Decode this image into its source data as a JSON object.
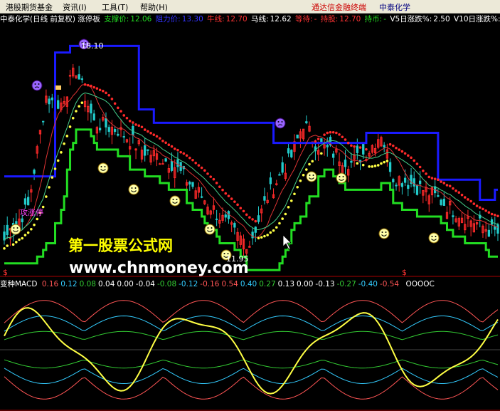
{
  "menu": {
    "items": [
      "港股期货基金",
      "资讯(I)",
      "工具(T)",
      "帮助(H)"
    ],
    "brand": "通达信金融终端",
    "stock": "中泰化学"
  },
  "info": {
    "title": "中泰化学(日线 前复权) 涨停板",
    "support_label": "支撑价:",
    "support_value": "12.06",
    "resist_label": "阻力价:",
    "resist_value": "13.30",
    "bull_label": "牛线:",
    "bull_value": "12.70",
    "horse_label": "马线:",
    "horse_value": "12.62",
    "wait_label": "等待:",
    "wait_value": "-",
    "hold_label": "持股:",
    "hold_value": "12.70",
    "cash_label": "持币:",
    "cash_value": "-",
    "v5_label": "V5日涨跌%:",
    "v5_value": "2.50",
    "v10_label": "V10日涨跌%:",
    "v10_value": "-"
  },
  "macd": {
    "label": "变种MACD",
    "values": [
      "0.16",
      "0.12",
      "0.08",
      "0.04",
      "0.00",
      "-0.04",
      "-0.08",
      "-0.12",
      "-0.16",
      "0.54",
      "0.40",
      "0.27",
      "0.13",
      "0.00",
      "-0.13",
      "-0.27",
      "-0.40",
      "-0.54"
    ],
    "colors": [
      "#ff5555",
      "#33ccff",
      "#33cc33",
      "#ffffff",
      "#ffffff",
      "#ffffff",
      "#33cc33",
      "#33ccff",
      "#ff5555",
      "#ff5555",
      "#33ccff",
      "#33cc33",
      "#ffffff",
      "#ffffff",
      "#ffffff",
      "#33cc33",
      "#33ccff",
      "#ff5555"
    ],
    "tail": "OOOOC"
  },
  "annotations": {
    "high_price": "18.10",
    "low_price": "11.95",
    "limit_up_text": "攻涨停",
    "dollar_1": "$",
    "dollar_2": "$"
  },
  "watermark": {
    "line1": "第一股票公式网",
    "line2": "www.chnmoney.com"
  },
  "colors": {
    "resistance": "#1a1aff",
    "support": "#22dd22",
    "up_candle": "#ff2a2a",
    "down_candle": "#22cccc",
    "red_dots": "#ff2a2a",
    "yellow_dots": "#ffff44",
    "macd_main": "#ffff44",
    "watermark1": "#ffff00",
    "watermark2": "#ffffff"
  },
  "chart_data": {
    "type": "candlestick",
    "price_high_marked": 18.1,
    "price_low_marked": 11.95,
    "resistance_line": [
      14.2,
      14.2,
      14.2,
      14.2,
      14.2,
      14.2,
      14.2,
      14.2,
      14.2,
      14.2,
      14.2,
      14.2,
      14.2,
      14.2,
      14.2,
      14.2,
      14.2,
      17.9,
      17.9,
      17.9,
      17.9,
      17.9,
      18.1,
      18.1,
      18.1,
      18.1,
      18.1,
      18.1,
      18.1,
      18.1,
      18.1,
      18.1,
      18.1,
      18.1,
      18.1,
      18.1,
      18.1,
      18.1,
      18.1,
      18.1,
      18.1,
      18.1,
      18.1,
      18.1,
      18.1,
      16.2,
      16.2,
      16.2,
      16.2,
      16.2,
      15.8,
      15.8,
      15.8,
      15.8,
      15.8,
      15.8,
      15.8,
      15.8,
      15.8,
      15.8,
      15.8,
      15.8,
      15.8,
      15.8,
      15.8,
      15.8,
      15.8,
      15.8,
      15.8,
      15.8,
      15.8,
      15.8,
      15.8,
      15.8,
      15.8,
      15.8,
      15.8,
      15.8,
      15.8,
      15.8,
      15.8,
      15.8,
      15.8,
      15.8,
      15.8,
      15.8,
      15.8,
      15.8,
      15.8,
      15.8,
      15.2,
      15.2,
      15.2,
      15.2,
      15.2,
      15.2,
      15.2,
      15.2,
      15.2,
      15.2,
      15.2,
      15.2,
      15.2,
      15.2,
      15.2,
      15.2,
      15.2,
      15.2,
      15.2,
      15.2,
      15.2,
      15.2,
      15.2,
      15.2,
      15.2,
      15.2,
      15.2,
      15.2,
      15.2,
      15.2,
      15.2,
      15.5,
      15.5,
      15.5,
      15.5,
      15.5,
      15.5,
      15.5,
      15.5,
      15.5,
      15.5,
      15.5,
      15.5,
      15.5,
      15.5,
      15.5,
      15.5,
      15.5,
      15.5,
      15.5,
      15.5,
      15.5,
      15.5,
      15.5,
      15.5,
      14.1,
      14.1,
      14.1,
      14.1,
      14.1,
      14.1,
      14.1,
      14.1,
      14.1,
      14.1,
      14.1,
      14.1,
      14.1,
      14.1,
      13.5,
      13.5,
      13.5,
      13.5,
      13.5,
      13.8,
      13.8
    ]
  }
}
